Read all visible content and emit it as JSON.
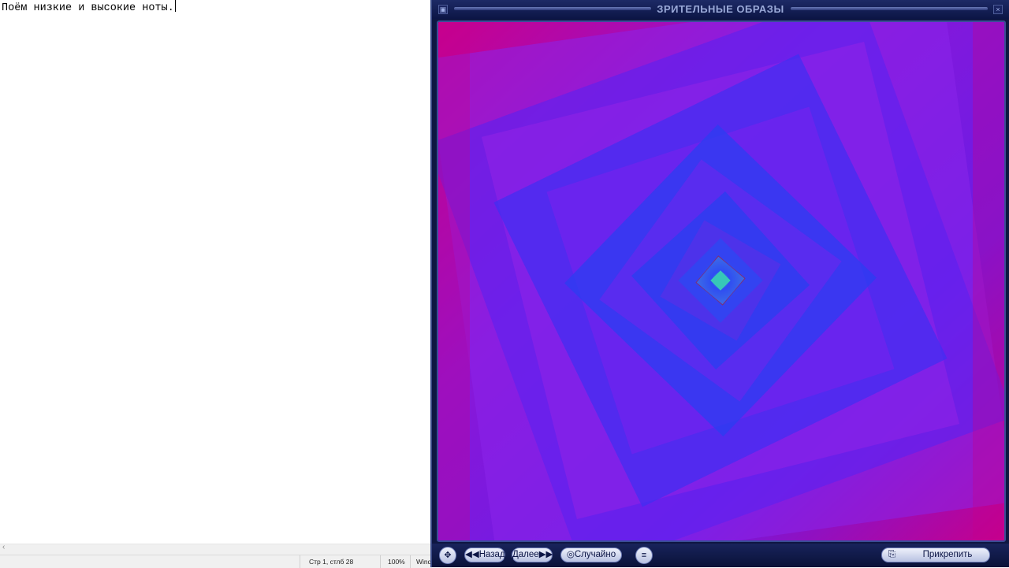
{
  "notepad": {
    "text": "Поём низкие и высокие ноты.",
    "status": {
      "position": "Стр 1, стлб 28",
      "zoom": "100%",
      "encoding_partial": "Wind"
    }
  },
  "visualization": {
    "title": "ЗРИТЕЛЬНЫЕ ОБРАЗЫ",
    "controls": {
      "back": "Назад",
      "next": "Далее",
      "random": "Случайно",
      "pin": "Прикрепить"
    },
    "colors": {
      "magenta": "#d2008c",
      "violet": "#7a1be8",
      "blue": "#2d3cf0",
      "frame": "#0e1742"
    },
    "icons": [
      "move-icon",
      "settings-icon",
      "pin-icon"
    ]
  }
}
